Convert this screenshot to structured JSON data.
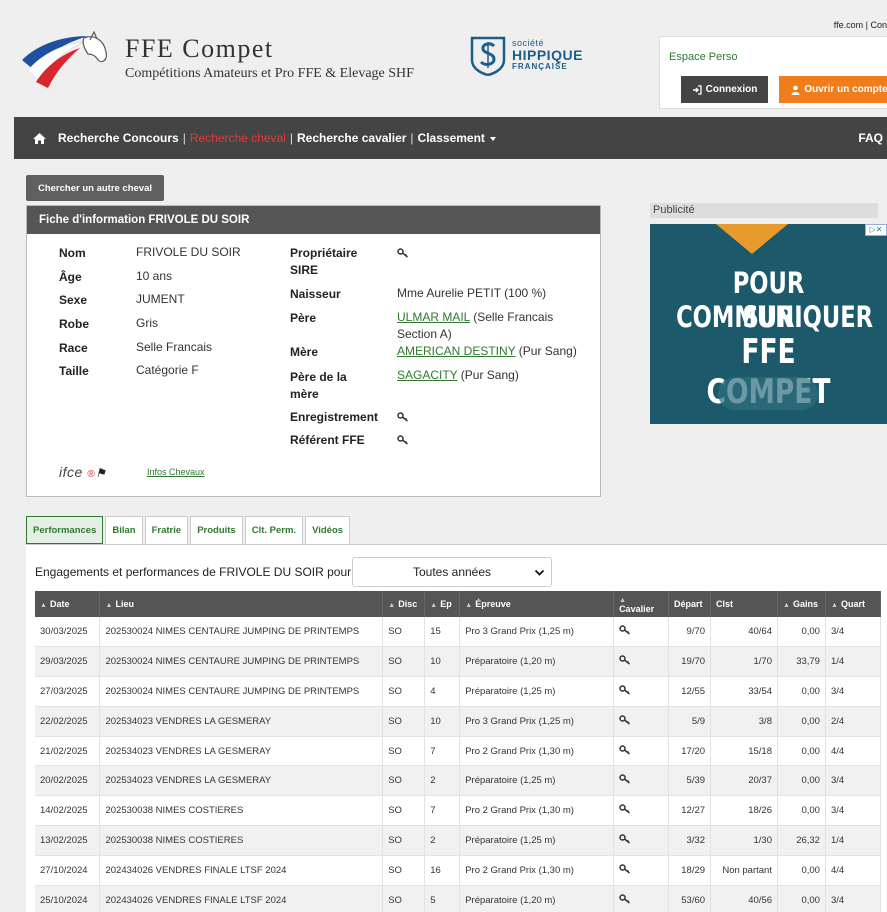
{
  "header": {
    "brand_title": "FFE Compet",
    "brand_subtitle": "Compétitions Amateurs et Pro FFE & Elevage SHF",
    "shf_line1": "société",
    "shf_line2": "HIPPIQUE",
    "shf_line3": "FRANÇAISE",
    "top_links": "ffe.com | Con"
  },
  "espace": {
    "title": "Espace Perso",
    "connexion_label": "Connexion",
    "ouvrir_label": "Ouvrir un compte"
  },
  "nav": {
    "items": [
      "Recherche Concours",
      "Recherche cheval",
      "Recherche cavalier",
      "Classement"
    ],
    "active_index": 1,
    "faq": "FAQ"
  },
  "chercher_label": "Chercher un autre cheval",
  "fiche": {
    "title": "Fiche d'information FRIVOLE DU SOIR",
    "left": [
      {
        "label": "Nom",
        "value": "FRIVOLE DU SOIR"
      },
      {
        "label": "Âge",
        "value": "10 ans"
      },
      {
        "label": "Sexe",
        "value": "JUMENT"
      },
      {
        "label": "Robe",
        "value": "Gris"
      },
      {
        "label": "Race",
        "value": "Selle Francais"
      },
      {
        "label": "Taille",
        "value": "Catégorie F"
      }
    ],
    "right": {
      "proprietaire_label": "Propriétaire",
      "sire_label": "SIRE",
      "naisseur_label": "Naisseur",
      "naisseur_value": "Mme Aurelie PETIT (100 %)",
      "pere_label": "Père",
      "pere_link": "ULMAR MAIL",
      "pere_race_a": " (Selle Francais",
      "pere_race_b": "Section A)",
      "mere_label": "Mère",
      "mere_link": "AMERICAN DESTINY",
      "mere_race": " (Pur Sang)",
      "pere_mere_label_a": "Père de la",
      "pere_mere_label_b": "mère",
      "pere_mere_link": "SAGACITY",
      "pere_mere_race": " (Pur Sang)",
      "enregistrement_label": "Enregistrement",
      "referent_label": "Référent FFE"
    },
    "ifce_logo": "ifce",
    "infos_link": "Infos Chevaux"
  },
  "pub": {
    "label": "Publicité",
    "line1": "POUR COMMUNIQUER",
    "line2": "SUR",
    "line3": "FFE COMPET"
  },
  "tabs": [
    "Performances",
    "Bilan",
    "Fratrie",
    "Produits",
    "Clt. Perm.",
    "Vidéos"
  ],
  "engagements_label": "Engagements et performances de FRIVOLE DU SOIR pour :",
  "select_value": "Toutes années",
  "table": {
    "headers": [
      "Date",
      "Lieu",
      "Disc",
      "Ep",
      "Épreuve",
      "Cavalier",
      "Départ",
      "Clst",
      "Gains",
      "Quart"
    ],
    "rows": [
      [
        "30/03/2025",
        "202530024 NIMES CENTAURE JUMPING DE PRINTEMPS",
        "SO",
        "15",
        "Pro 3 Grand Prix (1,25 m)",
        "9/70",
        "40/64",
        "0,00",
        "3/4"
      ],
      [
        "29/03/2025",
        "202530024 NIMES CENTAURE JUMPING DE PRINTEMPS",
        "SO",
        "10",
        "Préparatoire (1,20 m)",
        "19/70",
        "1/70",
        "33,79",
        "1/4"
      ],
      [
        "27/03/2025",
        "202530024 NIMES CENTAURE JUMPING DE PRINTEMPS",
        "SO",
        "4",
        "Préparatoire (1,25 m)",
        "12/55",
        "33/54",
        "0,00",
        "3/4"
      ],
      [
        "22/02/2025",
        "202534023 VENDRES LA GESMERAY",
        "SO",
        "10",
        "Pro 3 Grand Prix (1,25 m)",
        "5/9",
        "3/8",
        "0,00",
        "2/4"
      ],
      [
        "21/02/2025",
        "202534023 VENDRES LA GESMERAY",
        "SO",
        "7",
        "Pro 2 Grand Prix (1,30 m)",
        "17/20",
        "15/18",
        "0,00",
        "4/4"
      ],
      [
        "20/02/2025",
        "202534023 VENDRES LA GESMERAY",
        "SO",
        "2",
        "Préparatoire (1,25 m)",
        "5/39",
        "20/37",
        "0,00",
        "3/4"
      ],
      [
        "14/02/2025",
        "202530038 NIMES COSTIERES",
        "SO",
        "7",
        "Pro 2 Grand Prix (1,30 m)",
        "12/27",
        "18/26",
        "0,00",
        "3/4"
      ],
      [
        "13/02/2025",
        "202530038 NIMES COSTIERES",
        "SO",
        "2",
        "Préparatoire (1,25 m)",
        "3/32",
        "1/30",
        "26,32",
        "1/4"
      ],
      [
        "27/10/2024",
        "202434026 VENDRES FINALE LTSF 2024",
        "SO",
        "16",
        "Pro 2 Grand Prix (1,30 m)",
        "18/29",
        "Non partant",
        "0,00",
        "4/4"
      ],
      [
        "25/10/2024",
        "202434026 VENDRES FINALE LTSF 2024",
        "SO",
        "5",
        "Préparatoire (1,20 m)",
        "53/60",
        "40/56",
        "0,00",
        "3/4"
      ]
    ]
  },
  "colors": {
    "nav_bg": "#444444",
    "active_nav": "#e23a3a",
    "link_green": "#2f7a2f",
    "orange": "#f07d1c",
    "pub_bg": "#1c5a6b"
  }
}
